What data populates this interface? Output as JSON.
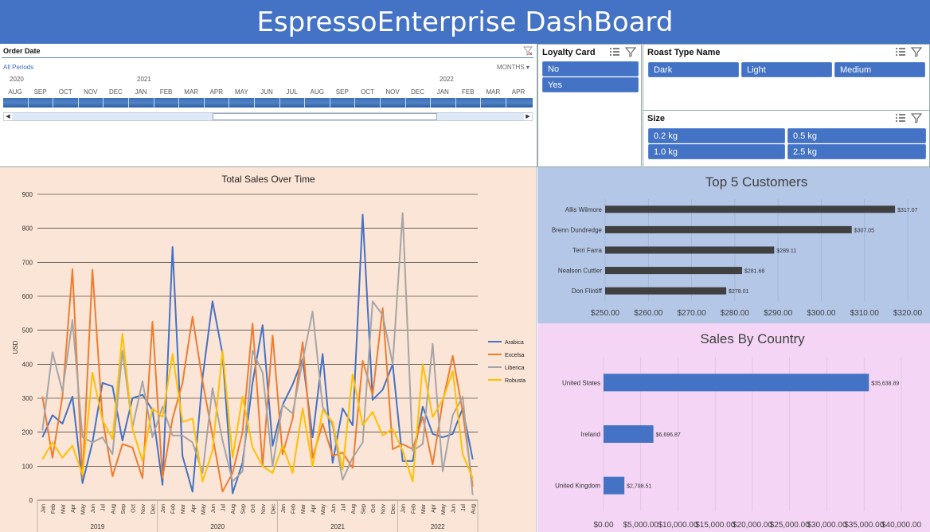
{
  "header": {
    "title": "EspressoEnterprise DashBoard"
  },
  "timeline": {
    "title": "Order Date",
    "all_periods": "All Periods",
    "level": "MONTHS",
    "years": [
      {
        "label": "2020"
      },
      {
        "label": "2021"
      },
      {
        "label": "2022"
      }
    ],
    "months": [
      "AUG",
      "SEP",
      "OCT",
      "NOV",
      "DEC",
      "JAN",
      "FEB",
      "MAR",
      "APR",
      "MAY",
      "JUN",
      "JUL",
      "AUG",
      "SEP",
      "OCT",
      "NOV",
      "DEC",
      "JAN",
      "FEB",
      "MAR",
      "APR"
    ]
  },
  "loyalty": {
    "title": "Loyalty Card",
    "options": [
      "No",
      "Yes"
    ]
  },
  "roast": {
    "title": "Roast Type Name",
    "options": [
      "Dark",
      "Light",
      "Medium"
    ]
  },
  "size": {
    "title": "Size",
    "options": [
      "0.2 kg",
      "0.5 kg",
      "1.0 kg",
      "2.5 kg"
    ]
  },
  "colors": {
    "header": "#4472c4",
    "slicer_button": "#4472c4",
    "line_bg": "#fbe5d6",
    "cust_bg": "#b4c7e7",
    "country_bg": "#f4d5f5"
  },
  "chart_data": [
    {
      "type": "line",
      "title": "Total Sales Over Time",
      "ylabel": "USD",
      "ylim": [
        0,
        900
      ],
      "yticks": [
        0,
        100,
        200,
        300,
        400,
        500,
        600,
        700,
        800,
        900
      ],
      "years": [
        "2019",
        "2020",
        "2021",
        "2022"
      ],
      "categories": [
        "Jan",
        "Feb",
        "Mar",
        "Apr",
        "May",
        "Jun",
        "Jul",
        "Aug",
        "Sep",
        "Oct",
        "Nov",
        "Dec",
        "Jan",
        "Feb",
        "Mar",
        "Apr",
        "May",
        "Jun",
        "Jul",
        "Aug",
        "Sep",
        "Oct",
        "Nov",
        "Dec",
        "Jan",
        "Feb",
        "Mar",
        "Apr",
        "May",
        "Jun",
        "Jul",
        "Aug",
        "Sep",
        "Oct",
        "Nov",
        "Dec",
        "Jan",
        "Feb",
        "Mar",
        "Apr",
        "May",
        "Jun",
        "Jul",
        "Aug"
      ],
      "series": [
        {
          "name": "Arabica",
          "color": "#4472c4",
          "values": [
            185,
            250,
            225,
            305,
            50,
            170,
            345,
            335,
            175,
            300,
            310,
            265,
            45,
            745,
            130,
            25,
            360,
            585,
            430,
            20,
            110,
            345,
            515,
            160,
            280,
            340,
            415,
            185,
            430,
            110,
            270,
            220,
            840,
            295,
            325,
            400,
            115,
            115,
            275,
            195,
            185,
            195,
            270,
            120
          ]
        },
        {
          "name": "Excelsa",
          "color": "#ed7d31",
          "values": [
            305,
            125,
            305,
            680,
            65,
            678,
            240,
            70,
            165,
            155,
            65,
            525,
            65,
            240,
            345,
            540,
            350,
            190,
            25,
            80,
            200,
            520,
            100,
            485,
            135,
            240,
            465,
            125,
            225,
            130,
            140,
            95,
            410,
            310,
            565,
            150,
            165,
            150,
            245,
            105,
            290,
            425,
            260,
            40
          ]
        },
        {
          "name": "Liberica",
          "color": "#a5a5a5",
          "values": [
            205,
            435,
            320,
            530,
            185,
            170,
            185,
            135,
            440,
            215,
            350,
            185,
            275,
            190,
            190,
            170,
            80,
            330,
            175,
            55,
            85,
            440,
            375,
            100,
            280,
            255,
            410,
            555,
            275,
            220,
            60,
            125,
            170,
            585,
            545,
            400,
            845,
            145,
            165,
            460,
            85,
            250,
            305,
            15
          ]
        },
        {
          "name": "Robusta",
          "color": "#ffc000",
          "values": [
            120,
            170,
            125,
            160,
            75,
            375,
            235,
            180,
            490,
            210,
            115,
            270,
            245,
            430,
            230,
            240,
            55,
            145,
            440,
            125,
            305,
            155,
            100,
            80,
            160,
            80,
            270,
            100,
            265,
            230,
            90,
            370,
            220,
            260,
            190,
            210,
            145,
            55,
            400,
            245,
            295,
            380,
            135,
            65
          ]
        }
      ],
      "legend": "right"
    },
    {
      "type": "bar",
      "title": "Top 5 Customers",
      "categories": [
        "Allis Wilmore",
        "Brenn Dundredge",
        "Terri Farra",
        "Nealson Cuttler",
        "Don Flintiff"
      ],
      "values": [
        317.07,
        307.05,
        289.11,
        281.68,
        278.01
      ],
      "value_labels": [
        "$317.07",
        "$307.05",
        "$289.11",
        "$281.68",
        "$278.01"
      ],
      "xlim": [
        250,
        320
      ],
      "xticks": [
        "$250.00",
        "$260.00",
        "$270.00",
        "$280.00",
        "$290.00",
        "$300.00",
        "$310.00",
        "$320.00"
      ],
      "color": "#404040"
    },
    {
      "type": "bar",
      "title": "Sales By Country",
      "categories": [
        "United States",
        "Ireland",
        "United Kingdom"
      ],
      "values": [
        35638.89,
        6696.87,
        2798.51
      ],
      "value_labels": [
        "$35,638.89",
        "$6,696.87",
        "$2,798.51"
      ],
      "xlim": [
        0,
        40000
      ],
      "xticks": [
        "$0.00",
        "$5,000.00",
        "$10,000.00",
        "$15,000.00",
        "$20,000.00",
        "$25,000.00",
        "$30,000.00",
        "$35,000.00",
        "$40,000.00"
      ],
      "color": "#4472c4"
    }
  ]
}
